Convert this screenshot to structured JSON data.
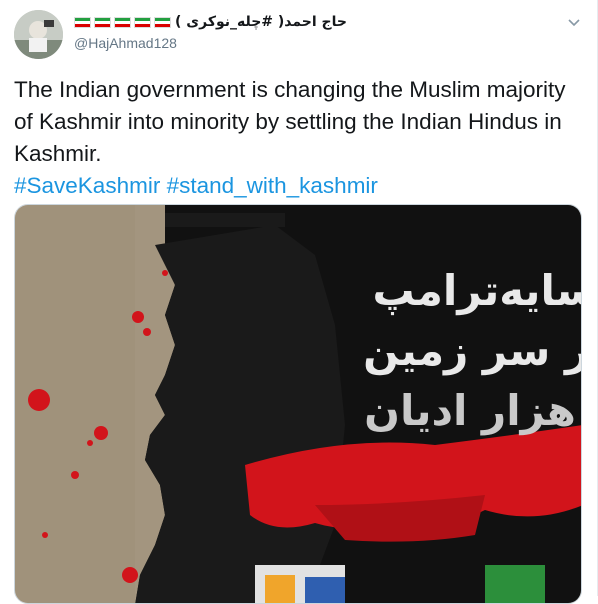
{
  "tweet": {
    "display_name": "حاج احمد( #چله_نوکری )",
    "flag_count": 5,
    "handle": "@HajAhmad128",
    "text": "The Indian government is changing the Muslim majority of Kashmir into minority by settling the Indian Hindus in Kashmir.",
    "hashtags": "#SaveKashmir #stand_with_kashmir",
    "media": {
      "poster_lines": [
        "سایه‌ترامپ",
        "بر سر زمین",
        "هزار ادیان"
      ]
    }
  },
  "colors": {
    "hashtag": "#1b95e0",
    "handle": "#657786",
    "poster_bg": "#a3957f",
    "poster_dark": "#111111",
    "blood": "#d2141b"
  },
  "icons": [
    "caret-down-icon",
    "iran-flag-icon"
  ]
}
